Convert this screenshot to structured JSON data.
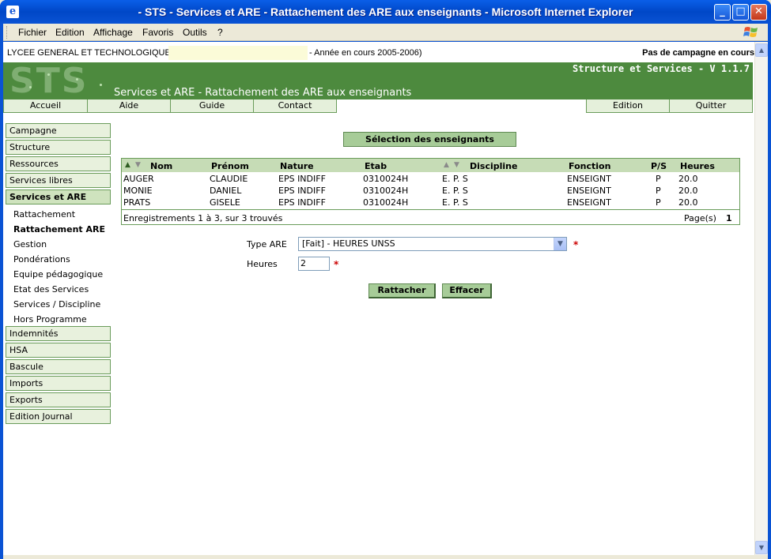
{
  "window": {
    "title": "- STS - Services et ARE - Rattachement des ARE aux enseignants - Microsoft Internet Explorer"
  },
  "menu": [
    "Fichier",
    "Edition",
    "Affichage",
    "Favoris",
    "Outils",
    "?"
  ],
  "topinfo": {
    "school": "LYCEE GENERAL ET TECHNOLOGIQUE",
    "year": "- Année en cours 2005-2006)",
    "campaign": "Pas de campagne en cours"
  },
  "banner": {
    "logo": "STS",
    "subtitle": "Structure et Services - V 1.1.7",
    "heading": "Services et ARE - Rattachement des ARE aux enseignants"
  },
  "topnav": {
    "left": [
      "Accueil",
      "Aide",
      "Guide",
      "Contact"
    ],
    "right": [
      "Edition",
      "Quitter"
    ]
  },
  "sidebar": {
    "sections_top": [
      "Campagne",
      "Structure",
      "Ressources",
      "Services libres"
    ],
    "active": "Services et ARE",
    "subitems": [
      "Rattachement",
      "Rattachement ARE",
      "Gestion",
      "Pondérations",
      "Equipe pédagogique",
      "Etat des Services",
      "Services / Discipline",
      "Hors Programme"
    ],
    "selected_subitem": "Rattachement ARE",
    "sections_bottom": [
      "Indemnités",
      "HSA",
      "Bascule",
      "Imports",
      "Exports",
      "Edition Journal"
    ]
  },
  "selection_button": "Sélection des enseignants",
  "table": {
    "columns": [
      "Nom",
      "Prénom",
      "Nature",
      "Etab",
      "Discipline",
      "Fonction",
      "P/S",
      "Heures"
    ],
    "rows": [
      [
        "AUGER",
        "CLAUDIE",
        "EPS INDIFF",
        "0310024H",
        "E. P. S",
        "ENSEIGNT",
        "P",
        "20.0"
      ],
      [
        "MONIE",
        "DANIEL",
        "EPS INDIFF",
        "0310024H",
        "E. P. S",
        "ENSEIGNT",
        "P",
        "20.0"
      ],
      [
        "PRATS",
        "GISELE",
        "EPS INDIFF",
        "0310024H",
        "E. P. S",
        "ENSEIGNT",
        "P",
        "20.0"
      ]
    ],
    "footer": "Enregistrements 1 à 3, sur 3 trouvés",
    "pages_label": "Page(s)",
    "page": "1"
  },
  "form": {
    "type_label": "Type ARE",
    "type_value": "[Fait] - HEURES UNSS",
    "hours_label": "Heures",
    "hours_value": "2",
    "required_mark": "*"
  },
  "actions": {
    "attach": "Rattacher",
    "clear": "Effacer"
  },
  "colors": {
    "banner": "#4d8a3e",
    "nav_bg": "#e5f0db",
    "button": "#a7cc98",
    "table_header": "#c6dcb6"
  }
}
